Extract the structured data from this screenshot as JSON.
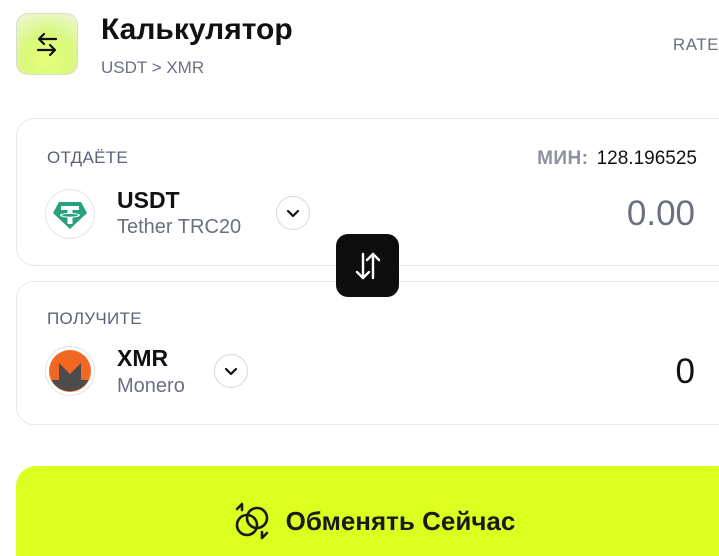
{
  "header": {
    "icon": "swap-arrows-icon",
    "title": "Калькулятор",
    "pair": "USDT > XMR",
    "rate_link": "RATE"
  },
  "give": {
    "label": "ОТДАЁТЕ",
    "min_label": "МИН:",
    "min_value": "128.196525",
    "coin_symbol": "USDT",
    "coin_name": "Tether TRC20",
    "coin_icon": "tether-icon",
    "amount": "0.00"
  },
  "get": {
    "label": "ПОЛУЧИТЕ",
    "coin_symbol": "XMR",
    "coin_name": "Monero",
    "coin_icon": "monero-icon",
    "amount": "0"
  },
  "swap_button": {
    "icon": "swap-vertical-icon"
  },
  "exchange_button": {
    "label": "Обменять Сейчас",
    "icon": "exchange-rings-icon",
    "color": "#dcff1f"
  },
  "colors": {
    "accent": "#dcff1f",
    "tether": "#26a17b",
    "monero": "#f26822"
  }
}
